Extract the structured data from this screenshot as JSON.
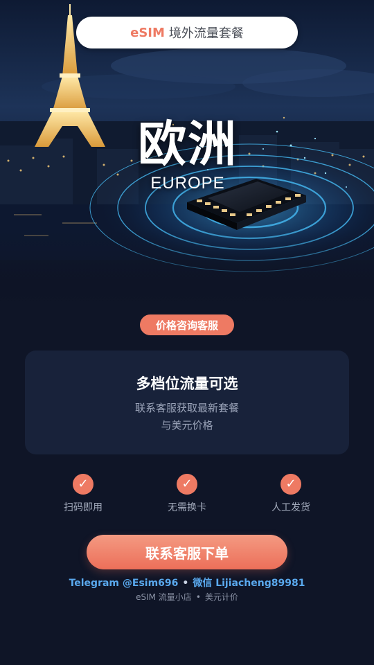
{
  "header": {
    "brand": "eSIM",
    "title": "境外流量套餐"
  },
  "hero": {
    "region_cn": "欧洲",
    "region_en": "EUROPE",
    "illustration": "eiffel-tower-night-city-with-glowing-esim-chip"
  },
  "consult_tag": "价格咨询客服",
  "info_card": {
    "title": "多档位流量可选",
    "line1": "联系客服获取最新套餐",
    "line2": "与美元价格"
  },
  "features": [
    {
      "icon": "check-icon",
      "label": "扫码即用"
    },
    {
      "icon": "check-icon",
      "label": "无需换卡"
    },
    {
      "icon": "check-icon",
      "label": "人工发货"
    }
  ],
  "cta_label": "联系客服下单",
  "contact": {
    "telegram": "Telegram @Esim696",
    "separator": "•",
    "wechat": "微信 Lijiacheng89981"
  },
  "footer": {
    "left": "eSIM 流量小店",
    "separator": "•",
    "right": "美元计价"
  },
  "colors": {
    "background": "#0f1527",
    "accent": "#ee7a63",
    "card": "#18223a",
    "link": "#5aa9ee"
  }
}
